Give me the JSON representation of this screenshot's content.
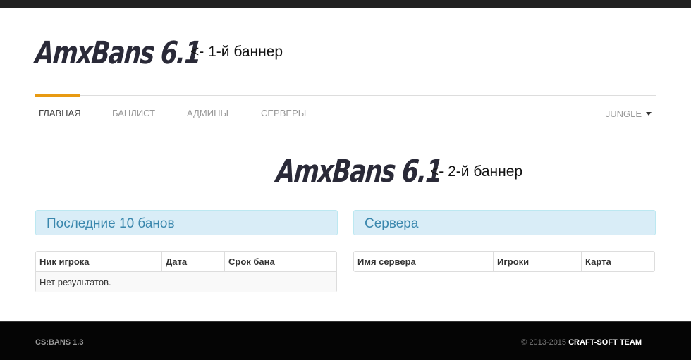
{
  "banner1": {
    "logo": "AmxBans 6.1",
    "note": "<- 1-й баннер"
  },
  "banner2": {
    "logo": "AmxBans 6.1",
    "note": "<- 2-й баннер"
  },
  "nav": {
    "items": [
      {
        "label": "ГЛАВНАЯ",
        "active": true
      },
      {
        "label": "БАНЛИСТ",
        "active": false
      },
      {
        "label": "АДМИНЫ",
        "active": false
      },
      {
        "label": "СЕРВЕРЫ",
        "active": false
      }
    ],
    "theme_dropdown": "JUNGLE",
    "accent_color": "#e89a12"
  },
  "bans_panel": {
    "title": "Последние 10 банов",
    "columns": [
      "Ник игрока",
      "Дата",
      "Срок бана"
    ],
    "empty_text": "Нет результатов."
  },
  "servers_panel": {
    "title": "Сервера",
    "columns": [
      "Имя сервера",
      "Игроки",
      "Карта"
    ]
  },
  "footer": {
    "left": "CS:BANS 1.3",
    "copyright": "© 2013-2015",
    "team_link": "CRAFT-SOFT TEAM"
  }
}
